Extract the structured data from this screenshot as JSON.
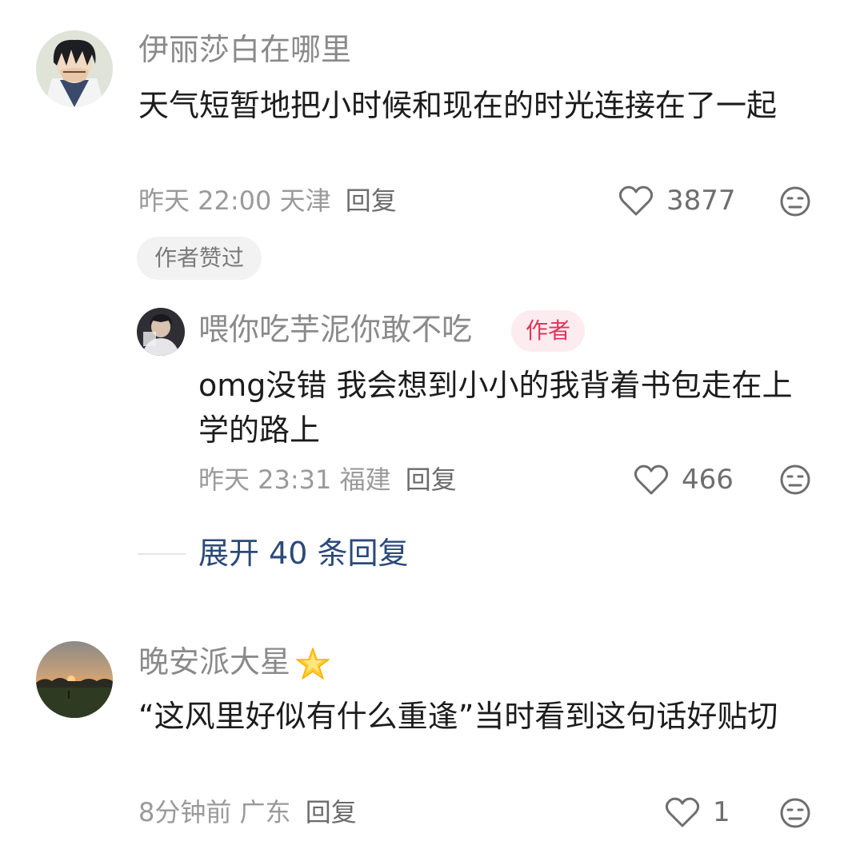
{
  "comments": [
    {
      "username": "伊丽莎白在哪里",
      "text": "天气短暂地把小时候和现在的时光连接在了一起",
      "time": "昨天 22:00 天津",
      "reply_label": "回复",
      "likes": "3877",
      "author_liked_badge": "作者赞过",
      "avatar_icon": "anime-character-avatar",
      "replies": [
        {
          "username": "喂你吃芋泥你敢不吃",
          "author_tag": "作者",
          "text": "omg没错 我会想到小小的我背着书包走在上学的路上",
          "time": "昨天 23:31 福建",
          "reply_label": "回复",
          "likes": "466",
          "avatar_icon": "photo-avatar"
        }
      ],
      "expand_label": "展开 40 条回复"
    },
    {
      "username": "晚安派大星",
      "username_emoji": "glowing-star-icon",
      "text": "“这风里好似有什么重逢”当时看到这句话好贴切",
      "time": "8分钟前 广东",
      "reply_label": "回复",
      "likes": "1",
      "avatar_icon": "sunset-avatar"
    }
  ],
  "colors": {
    "username": "#8a8a8a",
    "text": "#1c1c1c",
    "meta": "#9a9a9a",
    "author_tag_bg": "#fdecef",
    "author_tag_text": "#e0355a",
    "expand_link": "#2b4a78"
  }
}
